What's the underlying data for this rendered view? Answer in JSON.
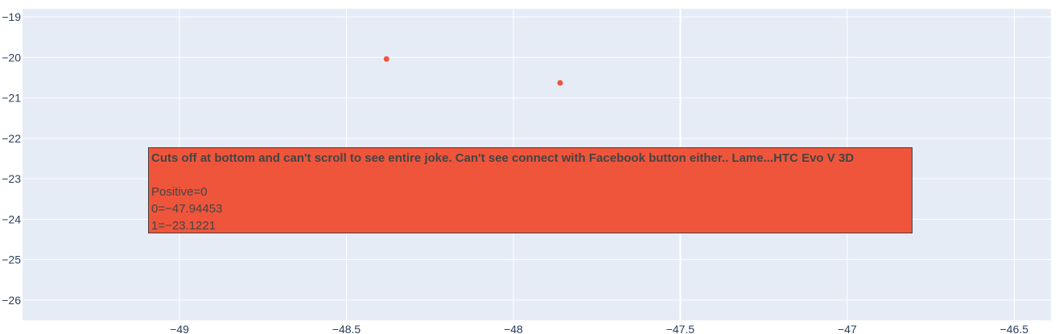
{
  "chart_data": {
    "type": "scatter",
    "title": "",
    "xlabel": "",
    "ylabel": "",
    "xlim": [
      -49.47,
      -46.39
    ],
    "ylim": [
      -26.5,
      -18.8
    ],
    "x_ticks": [
      -49,
      -48.5,
      -48,
      -47.5,
      -47,
      -46.5
    ],
    "x_tick_labels": [
      "−49",
      "−48.5",
      "−48",
      "−47.5",
      "−47",
      "−46.5"
    ],
    "y_ticks": [
      -19,
      -20,
      -21,
      -22,
      -23,
      -24,
      -25,
      -26
    ],
    "y_tick_labels": [
      "−19",
      "−20",
      "−21",
      "−22",
      "−23",
      "−24",
      "−25",
      "−26"
    ],
    "grid": true,
    "series": [
      {
        "color": "#ef553b",
        "points": [
          {
            "x": -48.38,
            "y": -20.04
          },
          {
            "x": -47.86,
            "y": -20.63
          },
          {
            "x": -47.94453,
            "y": -23.1221
          }
        ]
      }
    ],
    "colors": {
      "background": "#e5ecf6",
      "grid": "#ffffff",
      "marker": "#ef553b"
    }
  },
  "hover": {
    "title": "Cuts off at bottom and can't scroll to see entire joke. Can't see connect with Facebook button either.. Lame...HTC Evo V 3D",
    "lines": [
      "Positive=0",
      "0=−47.94453",
      "1=−23.1221"
    ]
  }
}
